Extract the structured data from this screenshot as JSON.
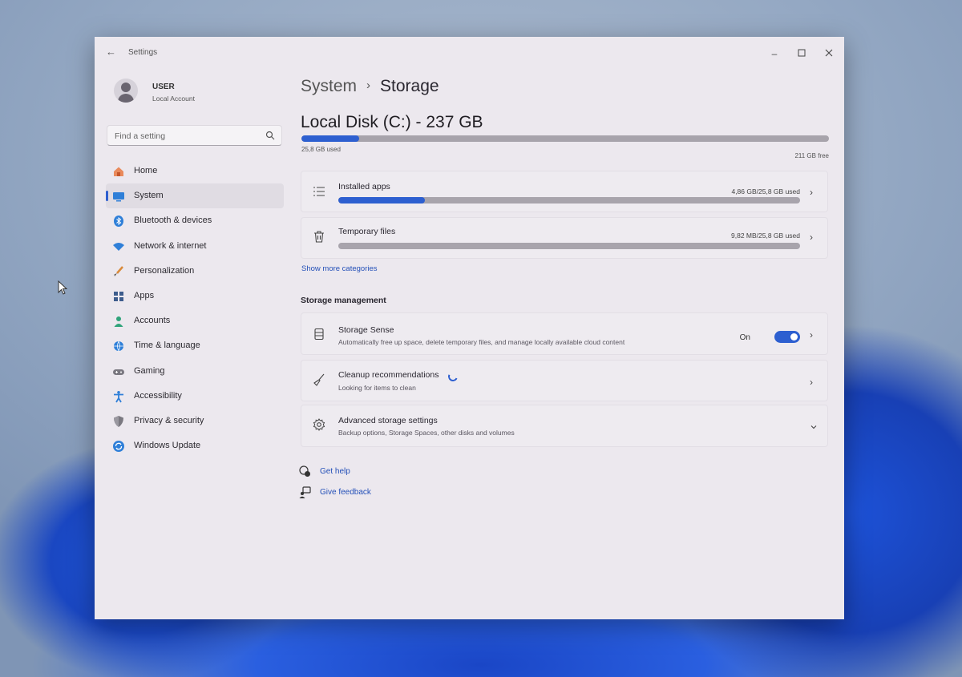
{
  "window": {
    "app_title": "Settings",
    "user": {
      "name": "USER",
      "account_type": "Local Account"
    },
    "search": {
      "placeholder": "Find a setting"
    }
  },
  "sidebar": {
    "items": [
      {
        "label": "Home",
        "icon": "home-icon",
        "active": false
      },
      {
        "label": "System",
        "icon": "system-icon",
        "active": true
      },
      {
        "label": "Bluetooth & devices",
        "icon": "bluetooth-icon",
        "active": false
      },
      {
        "label": "Network & internet",
        "icon": "wifi-icon",
        "active": false
      },
      {
        "label": "Personalization",
        "icon": "brush-icon",
        "active": false
      },
      {
        "label": "Apps",
        "icon": "apps-icon",
        "active": false
      },
      {
        "label": "Accounts",
        "icon": "accounts-icon",
        "active": false
      },
      {
        "label": "Time & language",
        "icon": "globe-icon",
        "active": false
      },
      {
        "label": "Gaming",
        "icon": "gamepad-icon",
        "active": false
      },
      {
        "label": "Accessibility",
        "icon": "accessibility-icon",
        "active": false
      },
      {
        "label": "Privacy & security",
        "icon": "shield-icon",
        "active": false
      },
      {
        "label": "Windows Update",
        "icon": "update-icon",
        "active": false
      }
    ]
  },
  "main": {
    "breadcrumb": {
      "parent": "System",
      "current": "Storage"
    },
    "disk": {
      "title": "Local Disk (C:) - 237 GB",
      "used_label": "25,8 GB used",
      "free_label": "211 GB free",
      "used_fraction": 0.109
    },
    "categories": [
      {
        "title": "Installed apps",
        "value": "4,86 GB/25,8 GB used",
        "icon": "list-icon",
        "fraction": 0.188
      },
      {
        "title": "Temporary files",
        "value": "9,82 MB/25,8 GB used",
        "icon": "trash-icon",
        "fraction": 0.0
      }
    ],
    "show_more": "Show more categories",
    "storage_management": {
      "heading": "Storage management",
      "storage_sense": {
        "title": "Storage Sense",
        "subtitle": "Automatically free up space, delete temporary files, and manage locally available cloud content",
        "toggle_label": "On",
        "toggle_on": true
      },
      "cleanup": {
        "title": "Cleanup recommendations",
        "subtitle": "Looking for items to clean"
      },
      "advanced": {
        "title": "Advanced storage settings",
        "subtitle": "Backup options, Storage Spaces, other disks and volumes"
      }
    },
    "help": {
      "get_help": "Get help",
      "give_feedback": "Give feedback"
    }
  },
  "colors": {
    "accent": "#2d5fd0",
    "window_bg": "#ece8ee",
    "link": "#2450b8"
  }
}
